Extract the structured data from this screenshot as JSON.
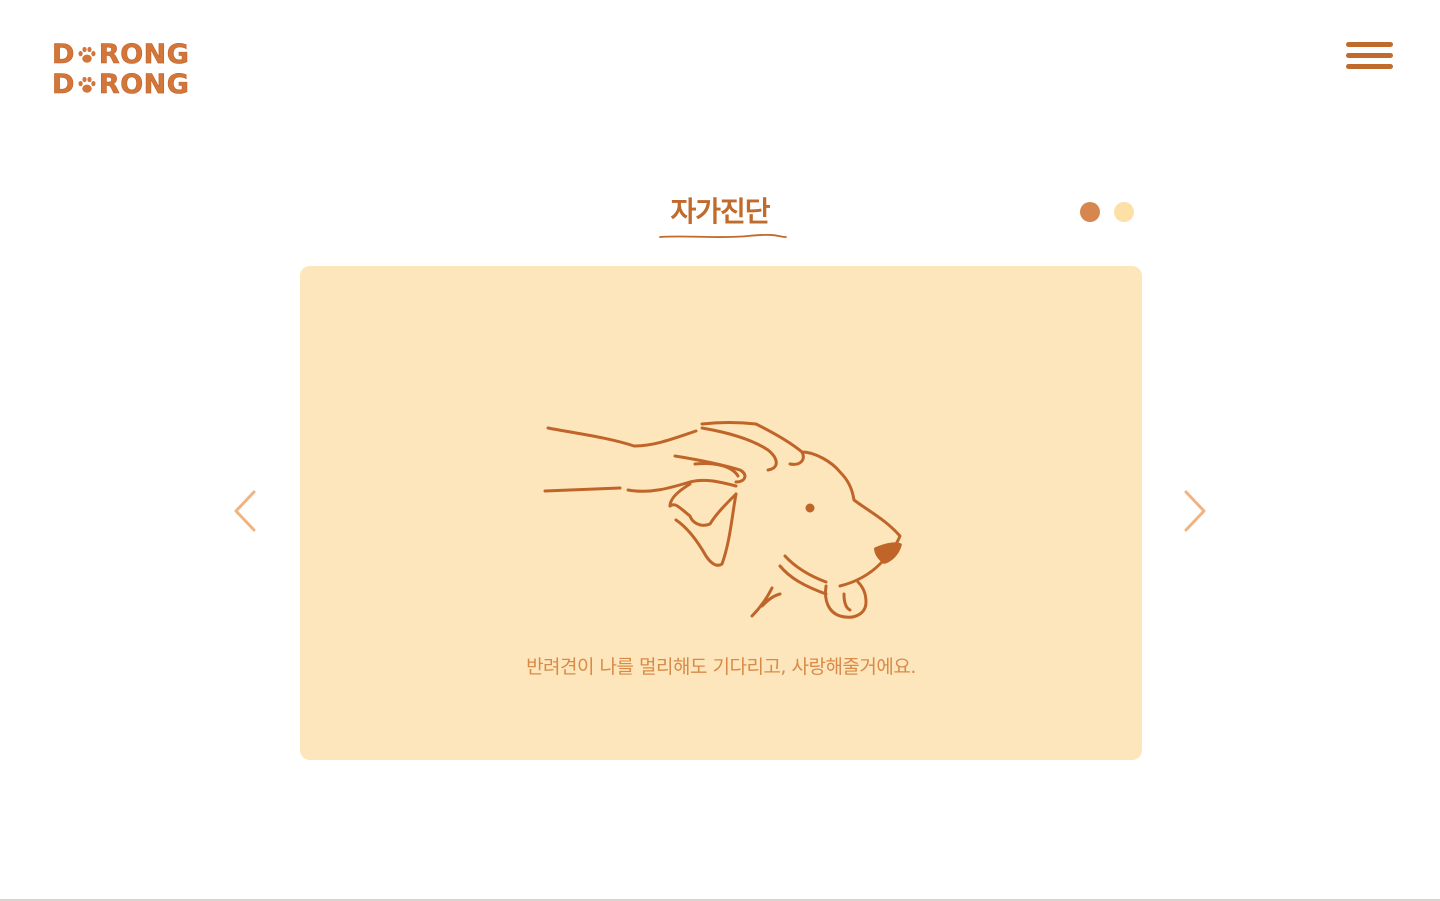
{
  "logo": {
    "line1_start": "D",
    "line1_end": "RONG",
    "line2_start": "D",
    "line2_end": "RONG",
    "paw_icon": "paw-icon"
  },
  "header": {
    "menu_icon": "hamburger-icon"
  },
  "section": {
    "title": "자가진단"
  },
  "carousel": {
    "slide_count": 2,
    "active_slide": 1,
    "prev_icon": "chevron-left-icon",
    "next_icon": "chevron-right-icon",
    "slides": [
      {
        "illustration": "hand-petting-dog-illustration",
        "caption": "반려견이 나를 멀리해도 기다리고, 사랑해줄거에요."
      }
    ]
  },
  "colors": {
    "brand": "#c06a2c",
    "logo": "#d2763a",
    "card_background": "#fde6bb",
    "caption_text": "#d98a48",
    "dot_active": "#d6874f",
    "dot_inactive": "#fde0a6",
    "arrow": "#f0b483",
    "line_art": "#c0652a"
  }
}
